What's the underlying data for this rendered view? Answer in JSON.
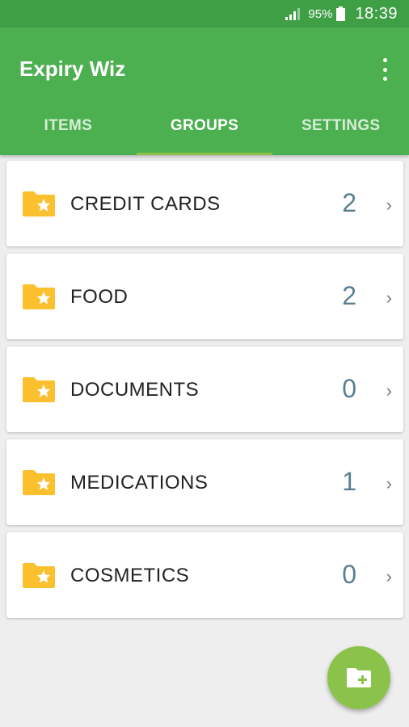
{
  "status_bar": {
    "battery": "95%",
    "time": "18:39"
  },
  "app_bar": {
    "title": "Expiry Wiz",
    "menu_icon": "more-vert-icon"
  },
  "tabs": [
    {
      "label": "ITEMS",
      "active": false
    },
    {
      "label": "GROUPS",
      "active": true
    },
    {
      "label": "SETTINGS",
      "active": false
    }
  ],
  "groups": [
    {
      "name": "CREDIT CARDS",
      "count": "2"
    },
    {
      "name": "FOOD",
      "count": "2"
    },
    {
      "name": "DOCUMENTS",
      "count": "0"
    },
    {
      "name": "MEDICATIONS",
      "count": "1"
    },
    {
      "name": "COSMETICS",
      "count": "0"
    }
  ],
  "fab": {
    "icon": "add-folder-icon"
  },
  "colors": {
    "primary": "#4caf50",
    "primary_dark": "#3f9f45",
    "accent": "#8bc34a",
    "folder": "#fbc02d",
    "count": "#5a7f91"
  }
}
